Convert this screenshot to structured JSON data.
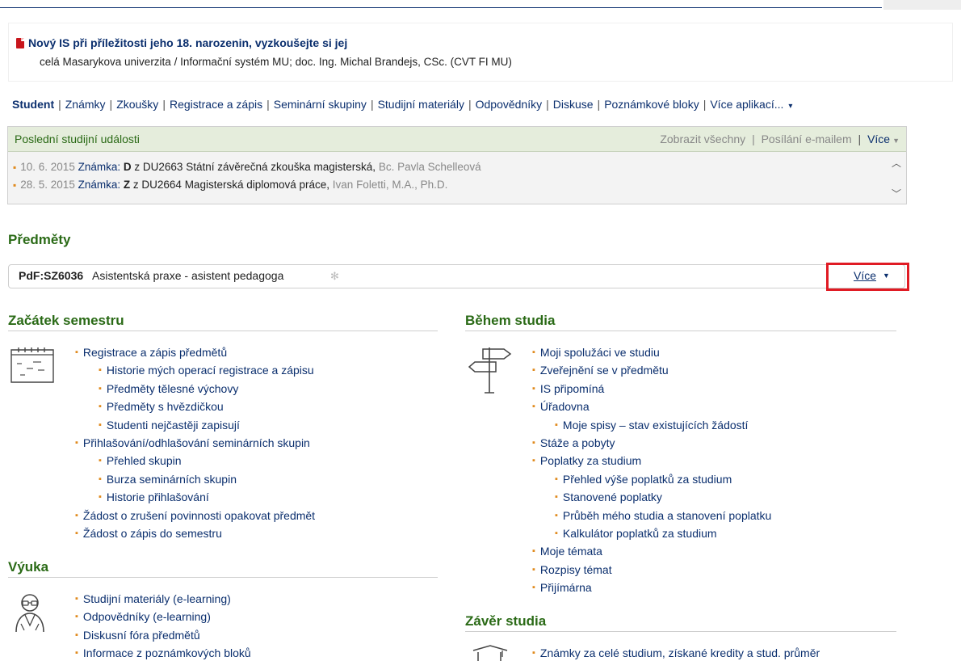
{
  "news": {
    "title": "Nový IS při příležitosti jeho 18. narozenin, vyzkoušejte si jej",
    "subtitle": "celá Masarykova univerzita / Informační systém MU; doc. Ing. Michal Brandejs, CSc. (CVT FI MU)"
  },
  "topnav": {
    "items": [
      "Student",
      "Známky",
      "Zkoušky",
      "Registrace a zápis",
      "Seminární skupiny",
      "Studijní materiály",
      "Odpovědníky",
      "Diskuse",
      "Poznámkové bloky",
      "Více aplikací..."
    ],
    "menu_arrow": "▾"
  },
  "events": {
    "title": "Poslední studijní události",
    "show_all": "Zobrazit všechny",
    "email": "Posílání e-mailem",
    "more": "Více",
    "rows": [
      {
        "date": "10. 6. 2015",
        "label": "Známka:",
        "grade": "D",
        "course": "z DU2663 Státní závěrečná zkouška magisterská,",
        "teacher": "Bc. Pavla Schelleová"
      },
      {
        "date": "28. 5. 2015",
        "label": "Známka:",
        "grade": "Z",
        "course": "z DU2664 Magisterská diplomová práce,",
        "teacher": "Ivan Foletti, M.A., Ph.D."
      }
    ]
  },
  "subjects": {
    "heading": "Předměty",
    "code": "PdF:SZ6036",
    "name": "Asistentská praxe - asistent pedagoga",
    "more": "Více"
  },
  "start": {
    "heading": "Začátek semestru",
    "items": [
      {
        "text": "Registrace a zápis předmětů",
        "level": 0
      },
      {
        "text": "Historie mých operací registrace a zápisu",
        "level": 1
      },
      {
        "text": "Předměty tělesné výchovy",
        "level": 1
      },
      {
        "text": "Předměty s hvězdičkou",
        "level": 1
      },
      {
        "text": "Studenti nejčastěji zapisují",
        "level": 1
      },
      {
        "text": "Přihlašování/odhlašování seminárních skupin",
        "level": 0
      },
      {
        "text": "Přehled skupin",
        "level": 1
      },
      {
        "text": "Burza seminárních skupin",
        "level": 1
      },
      {
        "text": "Historie přihlašování",
        "level": 1
      },
      {
        "text": "Žádost o zrušení povinnosti opakovat předmět",
        "level": 0
      },
      {
        "text": "Žádost o zápis do semestru",
        "level": 0
      }
    ]
  },
  "teaching": {
    "heading": "Výuka",
    "items": [
      {
        "text": "Studijní materiály (e-learning)",
        "level": 0
      },
      {
        "text": "Odpovědníky (e-learning)",
        "level": 0
      },
      {
        "text": "Diskusní fóra předmětů",
        "level": 0
      },
      {
        "text": "Informace z poznámkových bloků",
        "level": 0
      }
    ]
  },
  "during": {
    "heading": "Během studia",
    "items": [
      {
        "text": "Moji spolužáci ve studiu",
        "level": 0
      },
      {
        "text": "Zveřejnění se v předmětu",
        "level": 0
      },
      {
        "text": "IS připomíná",
        "level": 0
      },
      {
        "text": "Úřadovna",
        "level": 0
      },
      {
        "text": "Moje spisy – stav existujících žádostí",
        "level": 1
      },
      {
        "text": "Stáže a pobyty",
        "level": 0
      },
      {
        "text": "Poplatky za studium",
        "level": 0
      },
      {
        "text": "Přehled výše poplatků za studium",
        "level": 1
      },
      {
        "text": "Stanovené poplatky",
        "level": 1
      },
      {
        "text": "Průběh mého studia a stanovení poplatku",
        "level": 1
      },
      {
        "text": "Kalkulátor poplatků za studium",
        "level": 1
      },
      {
        "text": "Moje témata",
        "level": 0
      },
      {
        "text": "Rozpisy témat",
        "level": 0
      },
      {
        "text": "Přijímárna",
        "level": 0
      }
    ]
  },
  "end": {
    "heading": "Závěr studia",
    "items": [
      {
        "text": "Známky za celé studium, získané kredity a stud. průměr",
        "level": 0
      }
    ]
  },
  "colors": {
    "link": "#0b2f6e",
    "heading": "#2a6a16",
    "bullet": "#e08a1d",
    "highlight": "#e01b24"
  },
  "icons": [
    "pdf-icon",
    "calendar-icon",
    "signpost-icon",
    "teacher-icon",
    "graduation-icon",
    "gear-icon"
  ]
}
